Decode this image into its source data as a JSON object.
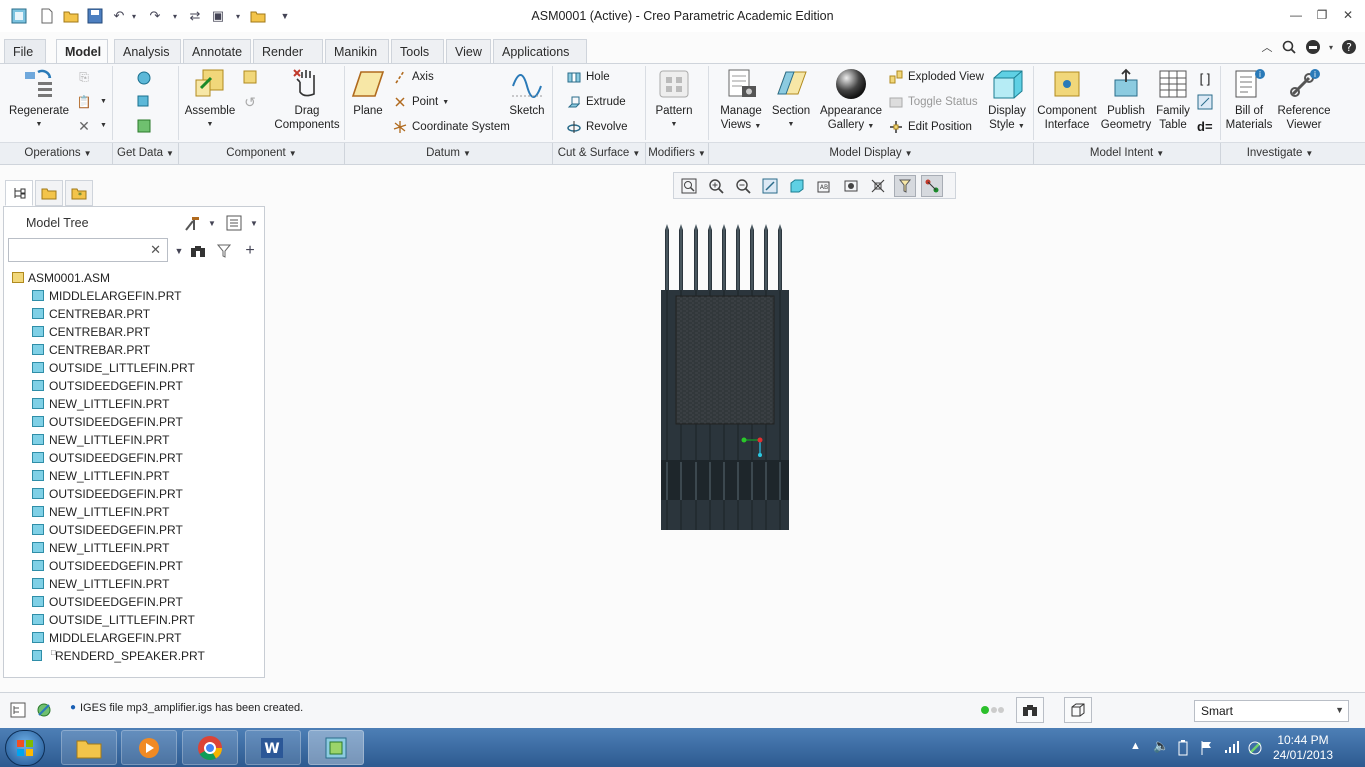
{
  "window": {
    "title": "ASM0001 (Active) - Creo Parametric Academic Edition"
  },
  "tabs": [
    {
      "label": "File",
      "has_arrow": true
    },
    {
      "label": "Model"
    },
    {
      "label": "Analysis"
    },
    {
      "label": "Annotate"
    },
    {
      "label": "Render"
    },
    {
      "label": "Manikin"
    },
    {
      "label": "Tools"
    },
    {
      "label": "View"
    },
    {
      "label": "Applications"
    }
  ],
  "ribbon": {
    "regenerate": "Regenerate",
    "assemble": "Assemble",
    "drag_components": [
      "Drag",
      "Components"
    ],
    "plane": "Plane",
    "axis": "Axis",
    "point": "Point",
    "coordinate_system": "Coordinate System",
    "sketch": "Sketch",
    "hole": "Hole",
    "extrude": "Extrude",
    "revolve": "Revolve",
    "pattern": "Pattern",
    "manage_views": [
      "Manage",
      "Views"
    ],
    "section": "Section",
    "appearance_gallery": [
      "Appearance",
      "Gallery"
    ],
    "exploded_view": "Exploded View",
    "toggle_status": "Toggle Status",
    "edit_position": "Edit Position",
    "display_style": [
      "Display",
      "Style"
    ],
    "component_interface": [
      "Component",
      "Interface"
    ],
    "publish_geometry": [
      "Publish",
      "Geometry"
    ],
    "family_table": [
      "Family",
      "Table"
    ],
    "bill_of_materials": [
      "Bill of",
      "Materials"
    ],
    "reference_viewer": [
      "Reference",
      "Viewer"
    ],
    "relations_symbol": "d="
  },
  "groups": [
    "Operations",
    "Get Data",
    "Component",
    "Datum",
    "Cut & Surface",
    "Modifiers",
    "Model Display",
    "Model Intent",
    "Investigate"
  ],
  "navigator": {
    "title": "Model Tree",
    "search_value": "",
    "tree": [
      "ASM0001.ASM",
      "MIDDLELARGEFIN.PRT",
      "CENTREBAR.PRT",
      "CENTREBAR.PRT",
      "CENTREBAR.PRT",
      "OUTSIDE_LITTLEFIN.PRT",
      "OUTSIDEEDGEFIN.PRT",
      "NEW_LITTLEFIN.PRT",
      "OUTSIDEEDGEFIN.PRT",
      "NEW_LITTLEFIN.PRT",
      "OUTSIDEEDGEFIN.PRT",
      "NEW_LITTLEFIN.PRT",
      "OUTSIDEEDGEFIN.PRT",
      "NEW_LITTLEFIN.PRT",
      "OUTSIDEEDGEFIN.PRT",
      "NEW_LITTLEFIN.PRT",
      "OUTSIDEEDGEFIN.PRT",
      "NEW_LITTLEFIN.PRT",
      "OUTSIDEEDGEFIN.PRT",
      "OUTSIDE_LITTLEFIN.PRT",
      "MIDDLELARGEFIN.PRT",
      "RENDERD_SPEAKER.PRT"
    ]
  },
  "status": {
    "message": "IGES file mp3_amplifier.igs has been created.",
    "filter": "Smart"
  },
  "taskbar": {
    "time": "10:44 PM",
    "date": "24/01/2013"
  },
  "colors": {
    "model_dark": "#2a343c",
    "model_body": "#3a464e",
    "accent_blue": "#2a7ab8"
  }
}
